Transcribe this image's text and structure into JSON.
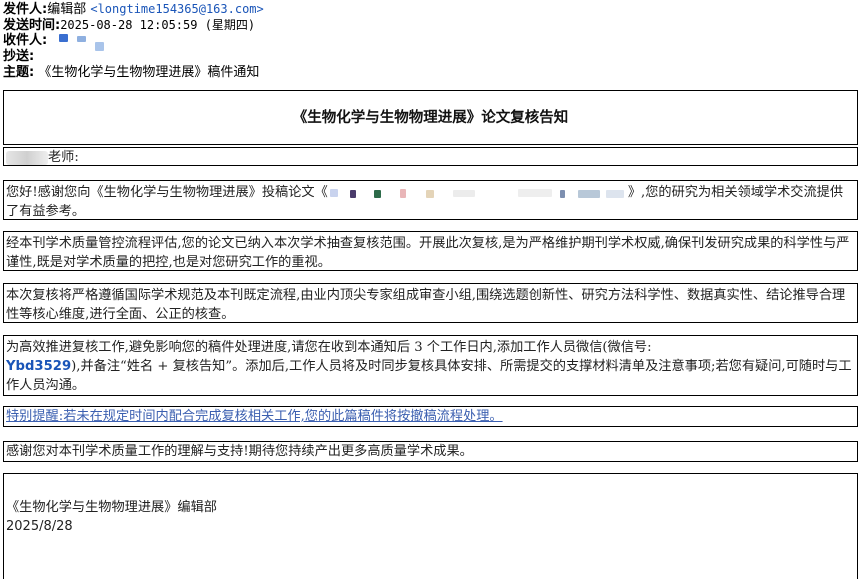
{
  "header": {
    "from_label": "发件人:",
    "from_name": "编辑部",
    "from_email": "<longtime154365@163.com>",
    "sent_label": "发送时间:",
    "sent_value": "2025-08-28 12:05:59 (星期四)",
    "to_label": "收件人:",
    "cc_label": "抄送:",
    "subject_label": "主题:",
    "subject_value": "《生物化学与生物物理进展》稿件通知"
  },
  "notice": {
    "title": "《生物化学与生物物理进展》论文复核告知",
    "greeting": "老师:",
    "p1_a": "您好!感谢您向《生物化学与生物物理进展》投稿论文《",
    "p1_b": "》,您的研究为相关领域学术交流提供了有益参考。",
    "p2": "经本刊学术质量管控流程评估,您的论文已纳入本次学术抽查复核范围。开展此次复核,是为严格维护期刊学术权威,确保刊发研究成果的科学性与严谨性,既是对学术质量的把控,也是对您研究工作的重视。",
    "p3": "本次复核将严格遵循国际学术规范及本刊既定流程,由业内顶尖专家组成审查小组,围绕选题创新性、研究方法科学性、数据真实性、结论推导合理性等核心维度,进行全面、公正的核查。",
    "p4_a": "为高效推进复核工作,避免影响您的稿件处理进度,请您在收到本通知后 3 个工作日内,添加工作人员微信(微信号:",
    "p4_wechat": "Ybd3529",
    "p4_b": "),并备注“姓名 + 复核告知”。添加后,工作人员将及时同步复核具体安排、所需提交的支撑材料清单及注意事项;若您有疑问,可随时与工作人员沟通。",
    "p5_warning": "特别提醒:若未在规定时间内配合完成复核相关工作,您的此篇稿件将按撤稿流程处理。",
    "p6": "感谢您对本刊学术质量工作的理解与支持!期待您持续产出更多高质量学术成果。",
    "sig_org": "《生物化学与生物物理进展》编辑部",
    "sig_date": "2025/8/28"
  },
  "colors": {
    "link_blue": "#1a55b8",
    "warning_blue": "#3b5fb0",
    "border": "#000000"
  }
}
